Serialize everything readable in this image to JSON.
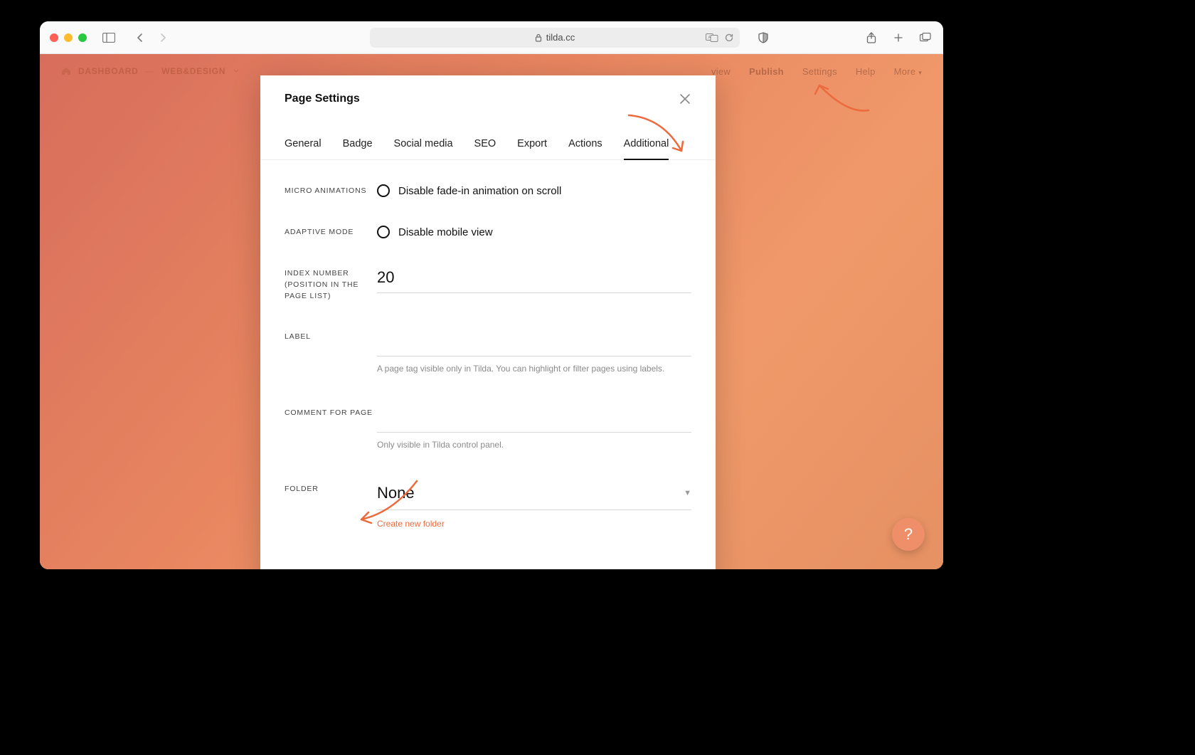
{
  "browser": {
    "url_host": "tilda.cc"
  },
  "topnav": {
    "crumb_home": "DASHBOARD",
    "crumb_project": "WEB&DESIGN",
    "right": {
      "preview": "view",
      "publish": "Publish",
      "settings": "Settings",
      "help": "Help",
      "more": "More"
    }
  },
  "modal": {
    "title": "Page Settings",
    "tabs": {
      "general": "General",
      "badge": "Badge",
      "social": "Social media",
      "seo": "SEO",
      "export": "Export",
      "actions": "Actions",
      "additional": "Additional"
    },
    "fields": {
      "micro_animations": {
        "label": "MICRO ANIMATIONS",
        "option": "Disable fade-in animation on scroll"
      },
      "adaptive_mode": {
        "label": "ADAPTIVE MODE",
        "option": "Disable mobile view"
      },
      "index_number": {
        "label": "INDEX NUMBER (POSITION IN THE PAGE LIST)",
        "value": "20"
      },
      "label_field": {
        "label": "LABEL",
        "value": "",
        "hint": "A page tag visible only in Tilda. You can highlight or filter pages using labels."
      },
      "comment": {
        "label": "COMMENT FOR PAGE",
        "value": "",
        "hint": "Only visible in Tilda control panel."
      },
      "folder": {
        "label": "FOLDER",
        "value": "None",
        "create_link": "Create new folder"
      }
    }
  },
  "fab": {
    "label": "?"
  }
}
